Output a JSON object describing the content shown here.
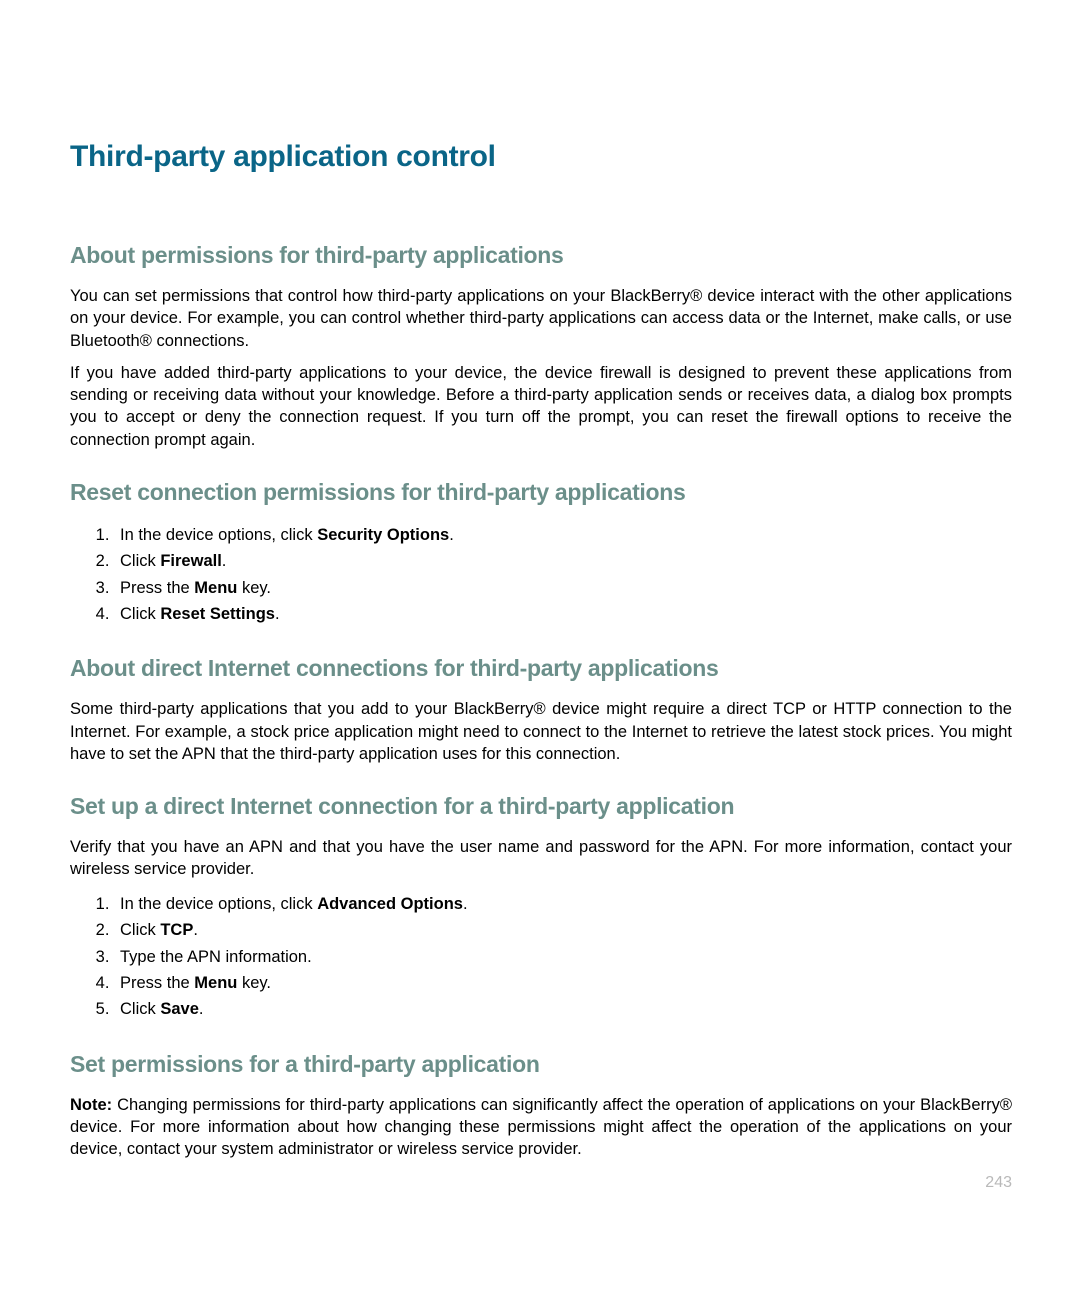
{
  "title": "Third-party application control",
  "page_number": "243",
  "sections": {
    "about_permissions": {
      "heading": "About permissions for third-party applications",
      "p1": "You can set permissions that control how third-party applications on your BlackBerry® device interact with the other applications on your device. For example, you can control whether third-party applications can access data or the Internet, make calls, or use Bluetooth® connections.",
      "p2": "If you have added third-party applications to your device, the device firewall is designed to prevent these applications from sending or receiving data without your knowledge. Before a third-party application sends or receives data, a dialog box prompts you to accept or deny the connection request. If you turn off the prompt, you can reset the firewall options to receive the connection prompt again."
    },
    "reset_conn": {
      "heading": "Reset connection permissions for third-party applications",
      "steps": {
        "s1_pre": "In the device options, click ",
        "s1_b": "Security Options",
        "s2_pre": "Click ",
        "s2_b": "Firewall",
        "s3_pre": "Press the ",
        "s3_b": "Menu",
        "s3_post": " key.",
        "s4_pre": "Click ",
        "s4_b": "Reset Settings"
      }
    },
    "about_direct": {
      "heading": "About direct Internet connections for third-party applications",
      "p1": "Some third-party applications that you add to your BlackBerry® device might require a direct TCP or HTTP connection to the Internet. For example, a stock price application might need to connect to the Internet to retrieve the latest stock prices. You might have to set the APN that the third-party application uses for this connection."
    },
    "setup_direct": {
      "heading": "Set up a direct Internet connection for a third-party application",
      "intro": "Verify that you have an APN and that you have the user name and password for the APN. For more information, contact your wireless service provider.",
      "steps": {
        "s1_pre": "In the device options, click ",
        "s1_b": "Advanced Options",
        "s2_pre": "Click ",
        "s2_b": "TCP",
        "s3": "Type the APN information.",
        "s4_pre": "Press the ",
        "s4_b": "Menu",
        "s4_post": " key.",
        "s5_pre": "Click ",
        "s5_b": "Save"
      }
    },
    "set_permissions": {
      "heading": "Set permissions for a third-party application",
      "note_label": "Note:",
      "note_text": "  Changing permissions for third-party applications can significantly affect the operation of applications on your BlackBerry® device. For more information about how changing these permissions might affect the operation of the applications on your device, contact your system administrator or wireless service provider."
    }
  }
}
